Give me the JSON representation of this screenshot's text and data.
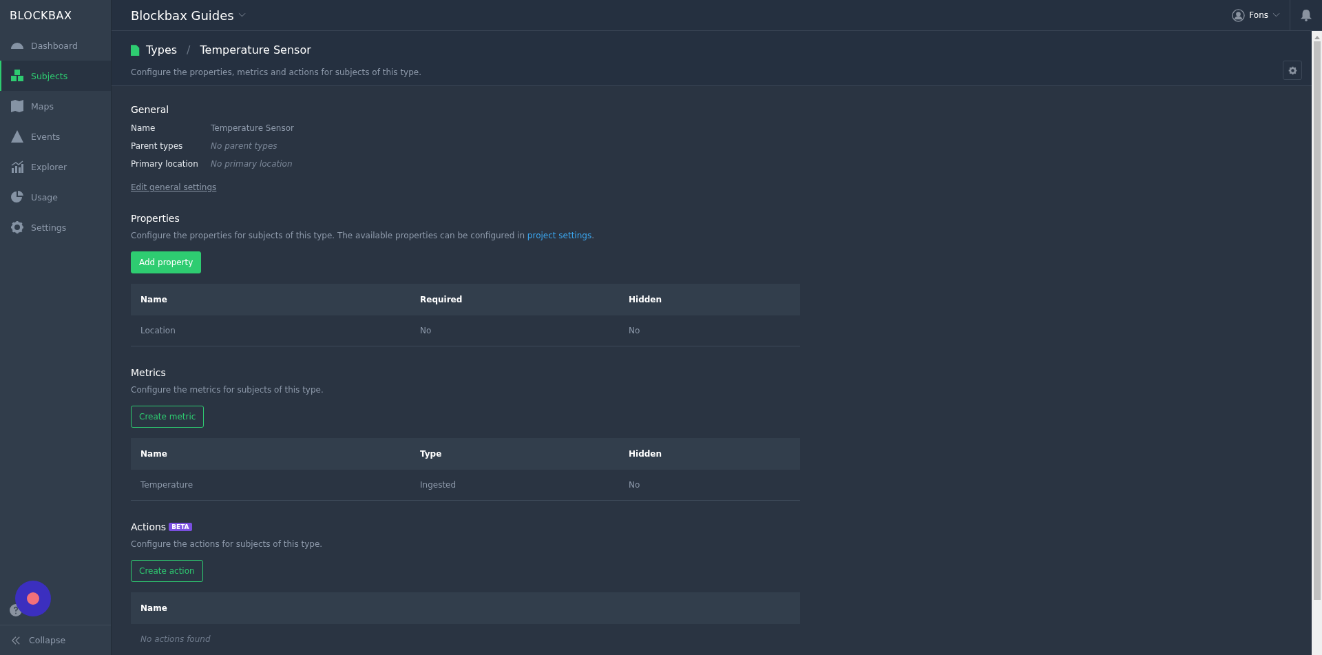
{
  "sidebar": {
    "logo": "BLOCKBAX",
    "items": [
      {
        "label": "Dashboard",
        "kind": "dashboard",
        "selected": false
      },
      {
        "label": "Subjects",
        "kind": "subjects",
        "selected": true
      },
      {
        "label": "Maps",
        "kind": "maps",
        "selected": false
      },
      {
        "label": "Events",
        "kind": "events",
        "selected": false
      },
      {
        "label": "Explorer",
        "kind": "explorer",
        "selected": false
      },
      {
        "label": "Usage",
        "kind": "usage",
        "selected": false
      },
      {
        "label": "Settings",
        "kind": "settings",
        "selected": false
      }
    ],
    "collapse": "Collapse"
  },
  "topbar": {
    "project": "Blockbax Guides",
    "user": "Fons"
  },
  "header": {
    "breadcrumb": [
      "Types",
      "/",
      "Temperature Sensor"
    ],
    "description": "Configure the properties, metrics and actions for subjects of this type."
  },
  "general": {
    "title": "General",
    "fields": [
      {
        "label": "Name",
        "value": "Temperature Sensor",
        "empty": false
      },
      {
        "label": "Parent types",
        "value": "No parent types",
        "empty": true
      },
      {
        "label": "Primary location",
        "value": "No primary location",
        "empty": true
      }
    ],
    "edit_link": "Edit general settings"
  },
  "sections": [
    {
      "title": "Properties",
      "description": "Configure the properties for subjects of this type. The available properties can be configured in ",
      "link": "project settings",
      "description_end": ".",
      "button": "Add property",
      "kind": "primary",
      "columns": [
        "Name",
        "Required",
        "Hidden"
      ],
      "rows": [
        [
          "Location",
          "No",
          "No"
        ]
      ]
    },
    {
      "title": "Metrics",
      "description": "Configure the metrics for subjects of this type.",
      "button": "Create metric",
      "kind": "secondary",
      "columns": [
        "Name",
        "Type",
        "Hidden"
      ],
      "rows": [
        [
          "Temperature",
          "Ingested",
          "No"
        ]
      ]
    },
    {
      "title": "Actions",
      "badge": "BETA",
      "description": "Configure the actions for subjects of this type.",
      "button": "Create action",
      "kind": "secondary",
      "columns": [
        "Name"
      ],
      "empty_text": "No actions found"
    }
  ]
}
